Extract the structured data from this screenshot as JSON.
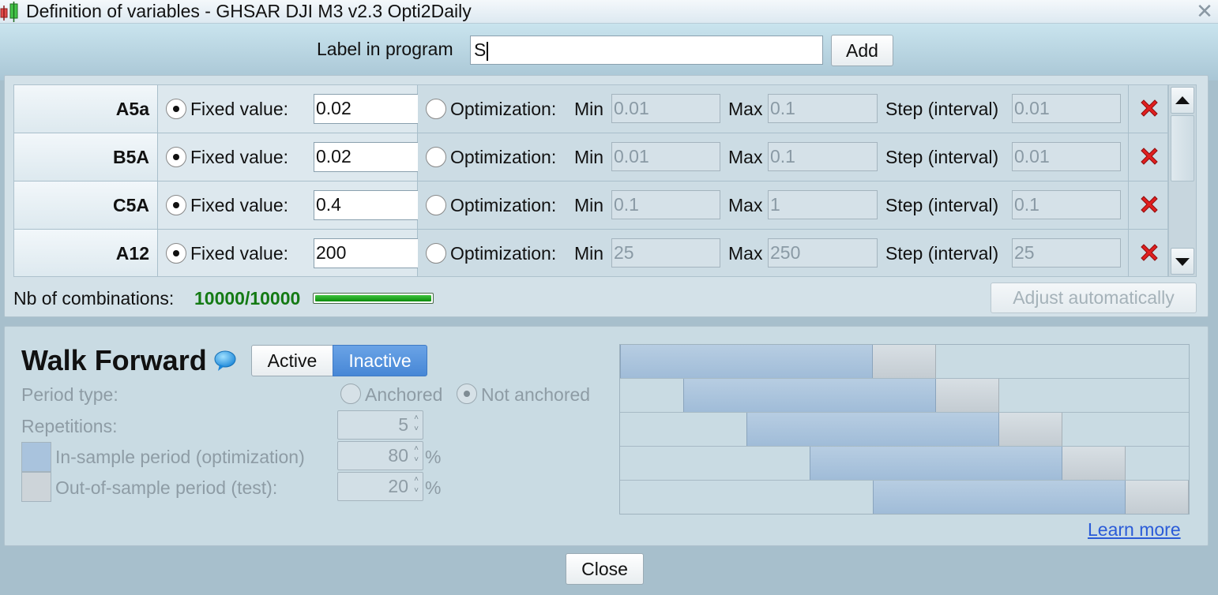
{
  "window": {
    "title": "Definition of variables - GHSAR DJI M3 v2.3 Opti2Daily",
    "app_icon": "candlestick-chart-icon",
    "close_icon": "close-icon"
  },
  "label_row": {
    "label": "Label in program",
    "input_value": "S",
    "add_label": "Add"
  },
  "variables": {
    "fixed_label": "Fixed value:",
    "opt_label": "Optimization:",
    "min_label": "Min",
    "max_label": "Max",
    "step_label": "Step (interval)",
    "rows": [
      {
        "name": "A5a",
        "fixed": "0.02",
        "min": "0.01",
        "max": "0.1",
        "step": "0.01",
        "mode": "fixed"
      },
      {
        "name": "B5A",
        "fixed": "0.02",
        "min": "0.01",
        "max": "0.1",
        "step": "0.01",
        "mode": "fixed"
      },
      {
        "name": "C5A",
        "fixed": "0.4",
        "min": "0.1",
        "max": "1",
        "step": "0.1",
        "mode": "fixed"
      },
      {
        "name": "A12",
        "fixed": "200",
        "min": "25",
        "max": "250",
        "step": "25",
        "mode": "fixed"
      }
    ],
    "delete_icon": "delete-x-icon"
  },
  "combinations": {
    "label": "Nb of combinations:",
    "value": "10000/10000",
    "progress_fraction": 1.0,
    "adjust_label": "Adjust automatically"
  },
  "walk_forward": {
    "title": "Walk Forward",
    "info_icon": "speech-bubble-icon",
    "active_label": "Active",
    "inactive_label": "Inactive",
    "selected": "Inactive",
    "period_type_label": "Period type:",
    "anchored_label": "Anchored",
    "not_anchored_label": "Not anchored",
    "period_selected": "Not anchored",
    "repetitions_label": "Repetitions:",
    "repetitions_value": "5",
    "in_sample_label": "In-sample period (optimization)",
    "in_sample_value": "80",
    "out_sample_label": "Out-of-sample period (test):",
    "out_sample_value": "20",
    "percent": "%",
    "in_sample_color": "#a9c3dd",
    "out_sample_color": "#cdd4d9",
    "learn_more": "Learn more"
  },
  "footer": {
    "close_label": "Close"
  }
}
